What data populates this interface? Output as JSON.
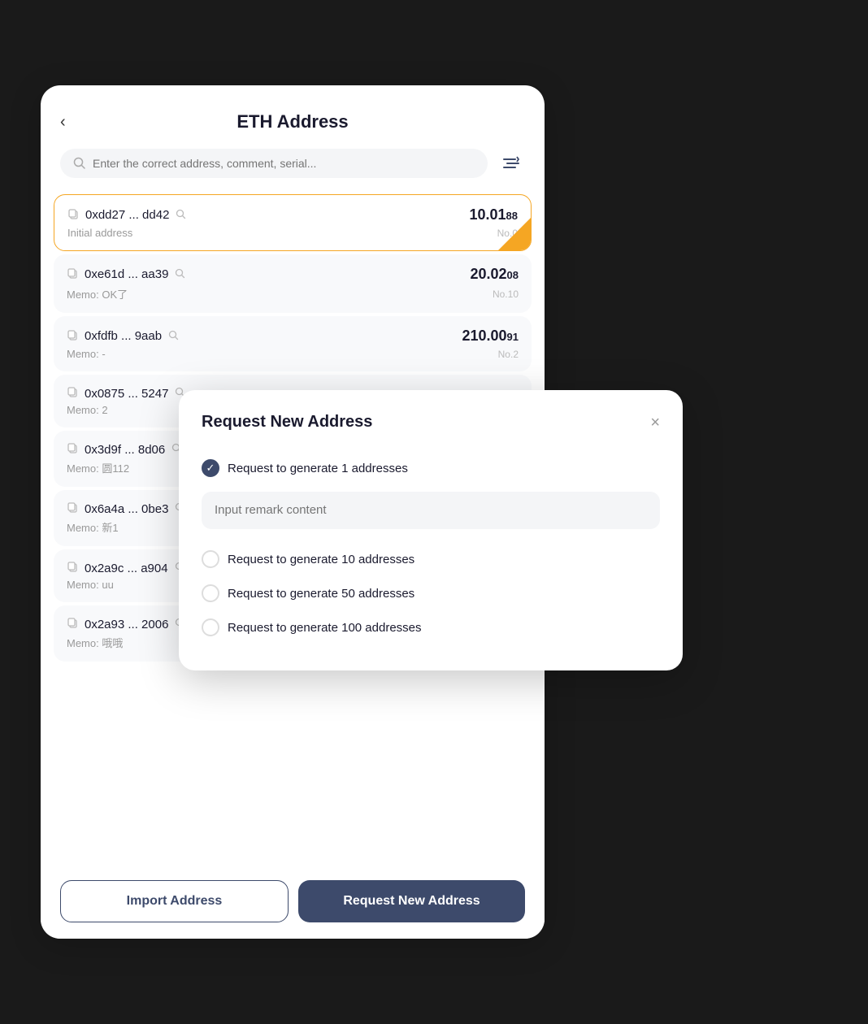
{
  "page": {
    "title": "ETH Address",
    "back_label": "‹",
    "search_placeholder": "Enter the correct address, comment, serial...",
    "filter_icon": "≡↕"
  },
  "address_list": [
    {
      "address": "0xdd27 ... dd42",
      "memo": "Initial address",
      "amount_main": "10.01",
      "amount_dec": "88",
      "no": "No.0",
      "active": true
    },
    {
      "address": "0xe61d ... aa39",
      "memo": "Memo: OK了",
      "amount_main": "20.02",
      "amount_dec": "08",
      "no": "No.10",
      "active": false
    },
    {
      "address": "0xfdfb ... 9aab",
      "memo": "Memo: -",
      "amount_main": "210.00",
      "amount_dec": "91",
      "no": "No.2",
      "active": false
    },
    {
      "address": "0x0875 ... 5247",
      "memo": "Memo: 2",
      "amount_main": "",
      "amount_dec": "",
      "no": "",
      "active": false
    },
    {
      "address": "0x3d9f ... 8d06",
      "memo": "Memo: 圆112",
      "amount_main": "",
      "amount_dec": "",
      "no": "",
      "active": false
    },
    {
      "address": "0x6a4a ... 0be3",
      "memo": "Memo: 新1",
      "amount_main": "",
      "amount_dec": "",
      "no": "",
      "active": false
    },
    {
      "address": "0x2a9c ... a904",
      "memo": "Memo: uu",
      "amount_main": "",
      "amount_dec": "",
      "no": "",
      "active": false
    },
    {
      "address": "0x2a93 ... 2006",
      "memo": "Memo: 哦哦",
      "amount_main": "",
      "amount_dec": "",
      "no": "",
      "active": false
    }
  ],
  "bottom_bar": {
    "import_label": "Import Address",
    "request_label": "Request New Address"
  },
  "modal": {
    "title": "Request New Address",
    "close_label": "×",
    "remark_placeholder": "Input remark content",
    "options": [
      {
        "label": "Request to generate 1 addresses",
        "checked": true
      },
      {
        "label": "Request to generate 10 addresses",
        "checked": false
      },
      {
        "label": "Request to generate 50 addresses",
        "checked": false
      },
      {
        "label": "Request to generate 100 addresses",
        "checked": false
      }
    ]
  }
}
